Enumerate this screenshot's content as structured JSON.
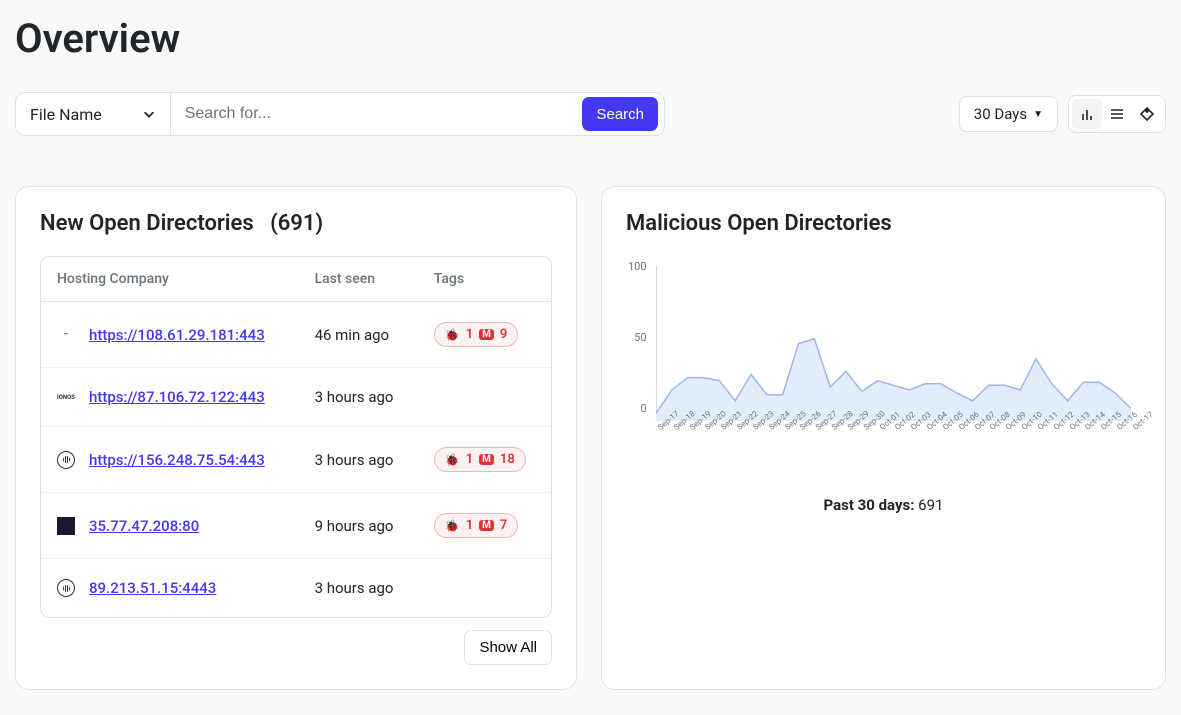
{
  "page_title": "Overview",
  "search": {
    "filter_label": "File Name",
    "placeholder": "Search for...",
    "button_label": "Search"
  },
  "time_range": {
    "label": "30 Days"
  },
  "new_open_directories": {
    "title_prefix": "New Open Directories",
    "count": "(691)",
    "columns": {
      "host": "Hosting Company",
      "last_seen": "Last seen",
      "tags": "Tags"
    },
    "rows": [
      {
        "icon_variant": "text",
        "icon_text": "—",
        "url": "https://108.61.29.181:443",
        "last_seen": "46 min ago",
        "tags": {
          "bug": "1",
          "m": "9"
        }
      },
      {
        "icon_variant": "text",
        "icon_text": "IONOS",
        "url": "https://87.106.72.122:443",
        "last_seen": "3 hours ago",
        "tags": null
      },
      {
        "icon_variant": "circle",
        "icon_text": "",
        "url": "https://156.248.75.54:443",
        "last_seen": "3 hours ago",
        "tags": {
          "bug": "1",
          "m": "18"
        }
      },
      {
        "icon_variant": "square-dark",
        "icon_text": "",
        "url": "35.77.47.208:80",
        "last_seen": "9 hours ago",
        "tags": {
          "bug": "1",
          "m": "7"
        }
      },
      {
        "icon_variant": "circle",
        "icon_text": "",
        "url": "89.213.51.15:4443",
        "last_seen": "3 hours ago",
        "tags": null
      }
    ],
    "show_all_label": "Show All"
  },
  "malicious_open_directories": {
    "title": "Malicious Open Directories",
    "summary_label": "Past 30 days:",
    "summary_value": "691"
  },
  "chart_data": {
    "type": "area",
    "title": "Malicious Open Directories",
    "xlabel": "",
    "ylabel": "",
    "ylim": [
      0,
      100
    ],
    "y_ticks": [
      "100",
      "50",
      "0"
    ],
    "categories": [
      "Sep-17",
      "Sep-18",
      "Sep-19",
      "Sep-20",
      "Sep-21",
      "Sep-22",
      "Sep-23",
      "Sep-24",
      "Sep-25",
      "Sep-26",
      "Sep-27",
      "Sep-28",
      "Sep-29",
      "Sep-30",
      "Oct-01",
      "Oct-02",
      "Oct-03",
      "Oct-04",
      "Oct-05",
      "Oct-06",
      "Oct-07",
      "Oct-08",
      "Oct-09",
      "Oct-10",
      "Oct-11",
      "Oct-12",
      "Oct-13",
      "Oct-14",
      "Oct-15",
      "Oct-16",
      "Oct-17"
    ],
    "values": [
      5,
      20,
      28,
      28,
      26,
      13,
      30,
      17,
      17,
      50,
      53,
      22,
      32,
      19,
      26,
      23,
      20,
      24,
      24,
      18,
      13,
      23,
      23,
      20,
      40,
      24,
      13,
      25,
      25,
      18,
      8
    ]
  }
}
